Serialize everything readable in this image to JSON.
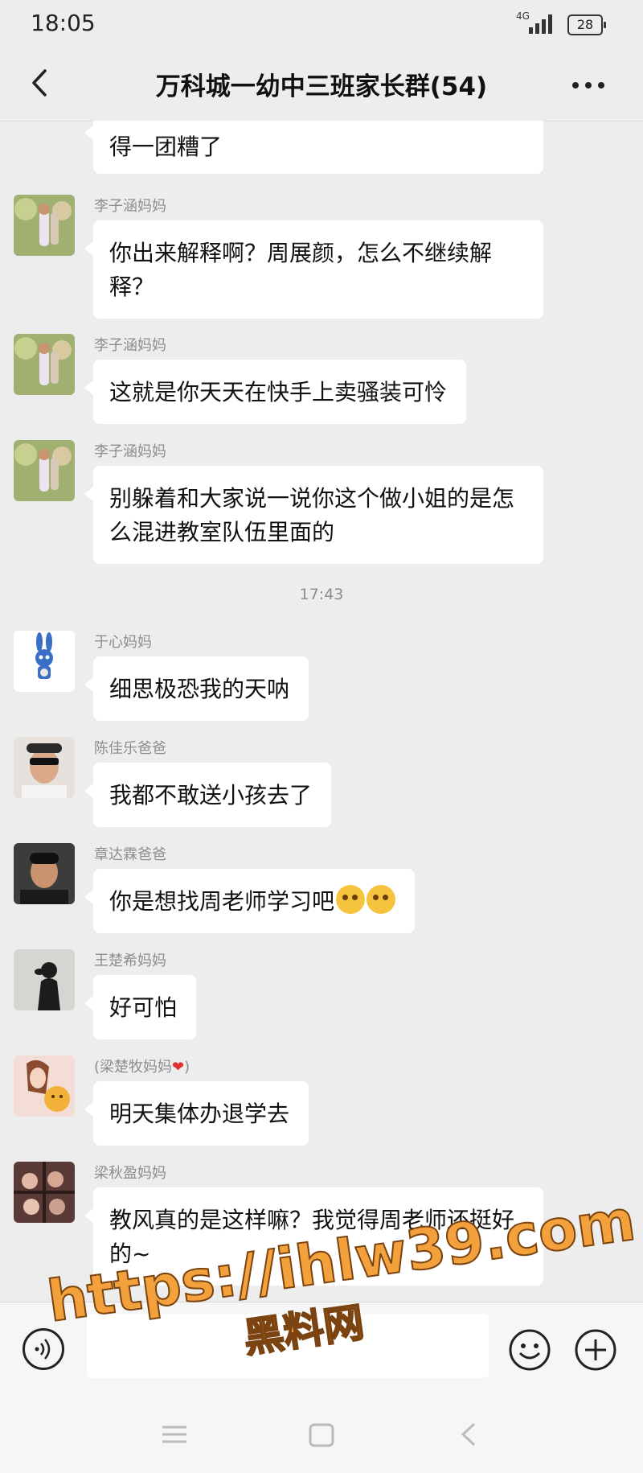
{
  "status": {
    "time": "18:05",
    "network": "4G",
    "battery": "28"
  },
  "header": {
    "title": "万科城一幼中三班家长群(54)"
  },
  "messages": [
    {
      "sender": "",
      "text": "得一团糟了"
    },
    {
      "sender": "李子涵妈妈",
      "text": "你出来解释啊？周展颜，怎么不继续解释？"
    },
    {
      "sender": "李子涵妈妈",
      "text": "这就是你天天在快手上卖骚装可怜"
    },
    {
      "sender": "李子涵妈妈",
      "text": "别躲着和大家说一说你这个做小姐的是怎么混进教室队伍里面的"
    },
    {
      "sender": "于心妈妈",
      "text": "细思极恐我的天呐"
    },
    {
      "sender": "陈佳乐爸爸",
      "text": "我都不敢送小孩去了"
    },
    {
      "sender": "章达霖爸爸",
      "text": "你是想找周老师学习吧"
    },
    {
      "sender": "王楚希妈妈",
      "text": "好可怕"
    },
    {
      "sender": "(梁楚牧妈妈",
      "sender_suffix": ")",
      "text": "明天集体办退学去"
    },
    {
      "sender": "梁秋盈妈妈",
      "text": "教风真的是这样嘛？我觉得周老师还挺好的~"
    }
  ],
  "timestamp": "17:43",
  "watermark": {
    "url": "https://ihlw39.com",
    "name": "黑料网"
  },
  "colors": {
    "background": "#ededed",
    "bubble": "#ffffff",
    "watermark": "#f2a13d"
  }
}
